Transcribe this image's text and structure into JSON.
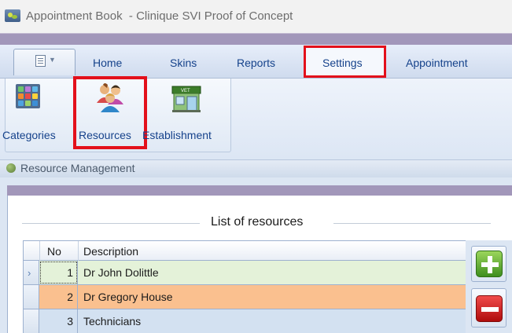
{
  "window": {
    "title": "Appointment Book  - Clinique SVI Proof of Concept"
  },
  "ribbon": {
    "tabs": [
      {
        "label": "Home"
      },
      {
        "label": "Skins"
      },
      {
        "label": "Reports"
      },
      {
        "label": "Settings",
        "selected": true,
        "highlighted": true
      },
      {
        "label": "Appointment"
      }
    ],
    "buttons": [
      {
        "label": "Categories",
        "icon": "categories-icon"
      },
      {
        "label": "Resources",
        "icon": "people-icon",
        "highlighted": true
      },
      {
        "label": "Establishment",
        "icon": "shop-icon"
      }
    ]
  },
  "resource_management": {
    "header": "Resource Management",
    "list_title": "List of resources",
    "columns": [
      "No",
      "Description"
    ],
    "rows": [
      {
        "no": "1",
        "description": "Dr John Dolittle",
        "state": "current"
      },
      {
        "no": "2",
        "description": "Dr Gregory House",
        "state": "selected"
      },
      {
        "no": "3",
        "description": "Technicians",
        "state": "normal"
      }
    ],
    "actions": [
      {
        "name": "add",
        "icon": "plus-icon",
        "color": "#3e8e1e"
      },
      {
        "name": "remove",
        "icon": "minus-icon",
        "color": "#d01a1a"
      }
    ]
  },
  "colors": {
    "highlight_box": "#e3101b",
    "row_current": "#e4f2d9",
    "row_selected": "#fac08f",
    "row_normal": "#d3e1f1",
    "purple_band": "#a297ba",
    "tab_text": "#15428b"
  }
}
